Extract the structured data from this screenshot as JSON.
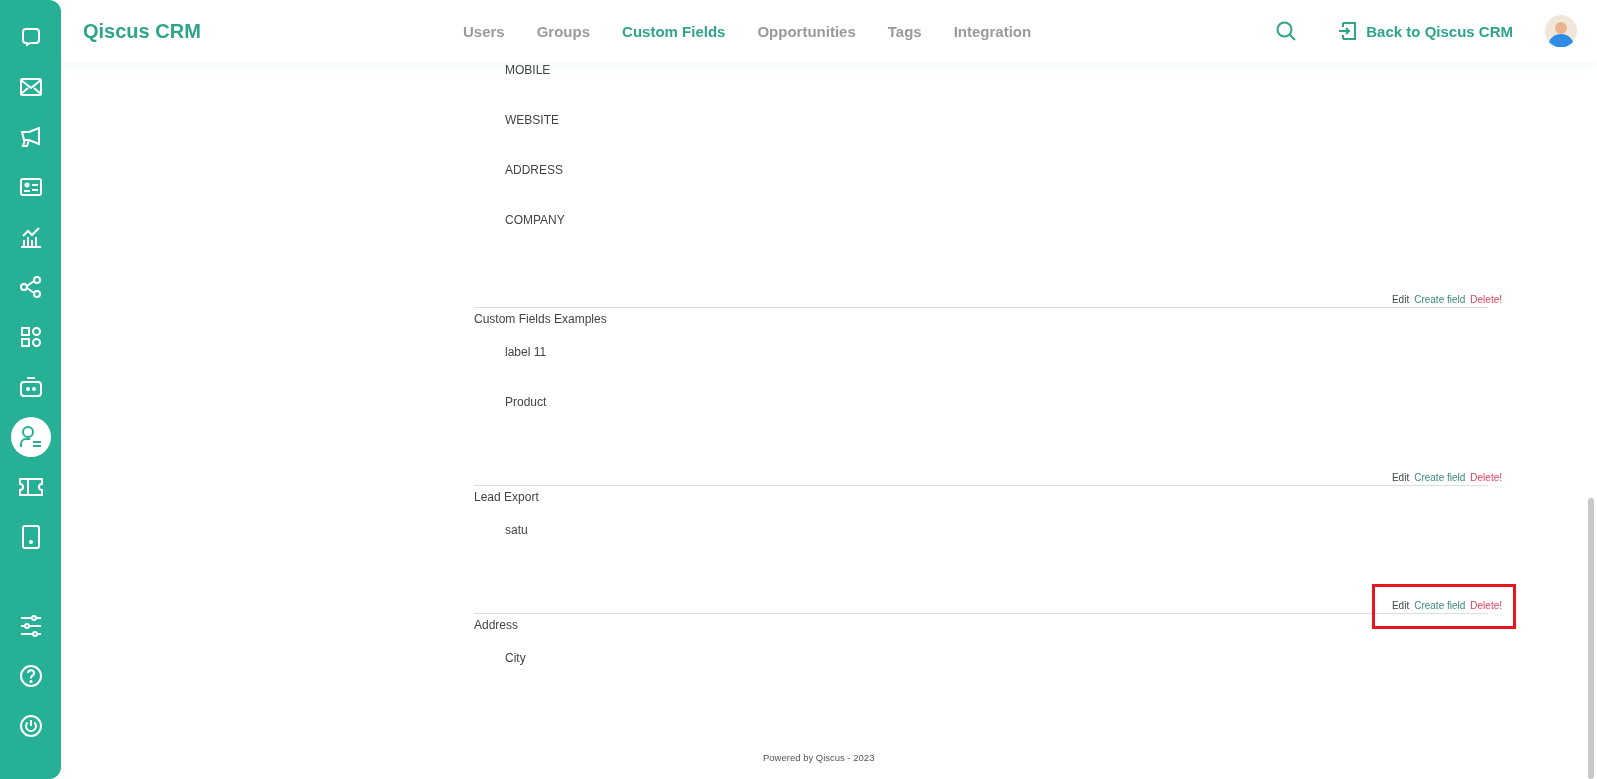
{
  "sidebar": {
    "items": [
      {
        "kind": "chat",
        "selected": false
      },
      {
        "kind": "mail",
        "selected": false
      },
      {
        "kind": "megaphone",
        "selected": false
      },
      {
        "kind": "contact",
        "selected": false
      },
      {
        "kind": "chart",
        "selected": false
      },
      {
        "kind": "share",
        "selected": false
      },
      {
        "kind": "apps",
        "selected": false
      },
      {
        "kind": "robot",
        "selected": false
      },
      {
        "kind": "agent",
        "selected": true
      },
      {
        "kind": "ticket",
        "selected": false
      },
      {
        "kind": "tablet",
        "selected": false
      }
    ],
    "bottom_items": [
      {
        "kind": "sliders",
        "selected": false
      },
      {
        "kind": "help",
        "selected": false
      },
      {
        "kind": "power",
        "selected": false
      }
    ]
  },
  "header": {
    "brand": "Qiscus CRM",
    "tabs": [
      {
        "label": "Users",
        "selected": false
      },
      {
        "label": "Groups",
        "selected": false
      },
      {
        "label": "Custom Fields",
        "selected": true
      },
      {
        "label": "Opportunities",
        "selected": false
      },
      {
        "label": "Tags",
        "selected": false
      },
      {
        "label": "Integration",
        "selected": false
      }
    ],
    "back_link": "Back to Qiscus CRM"
  },
  "groups": [
    {
      "fields": [
        "MOBILE",
        "WEBSITE",
        "ADDRESS",
        "COMPANY"
      ]
    },
    {
      "actions": {
        "edit": "Edit",
        "create": "Create field",
        "delete": "Delete!"
      },
      "title": "Custom Fields Examples",
      "fields": [
        "label 11",
        "Product"
      ]
    },
    {
      "actions": {
        "edit": "Edit",
        "create": "Create field",
        "delete": "Delete!"
      },
      "title": "Lead Export",
      "fields": [
        "satu"
      ]
    },
    {
      "actions": {
        "edit": "Edit",
        "create": "Create field",
        "delete": "Delete!",
        "highlighted": true
      },
      "title": "Address",
      "fields": [
        "City"
      ]
    }
  ],
  "footer": "Powered by Qiscus - 2023"
}
